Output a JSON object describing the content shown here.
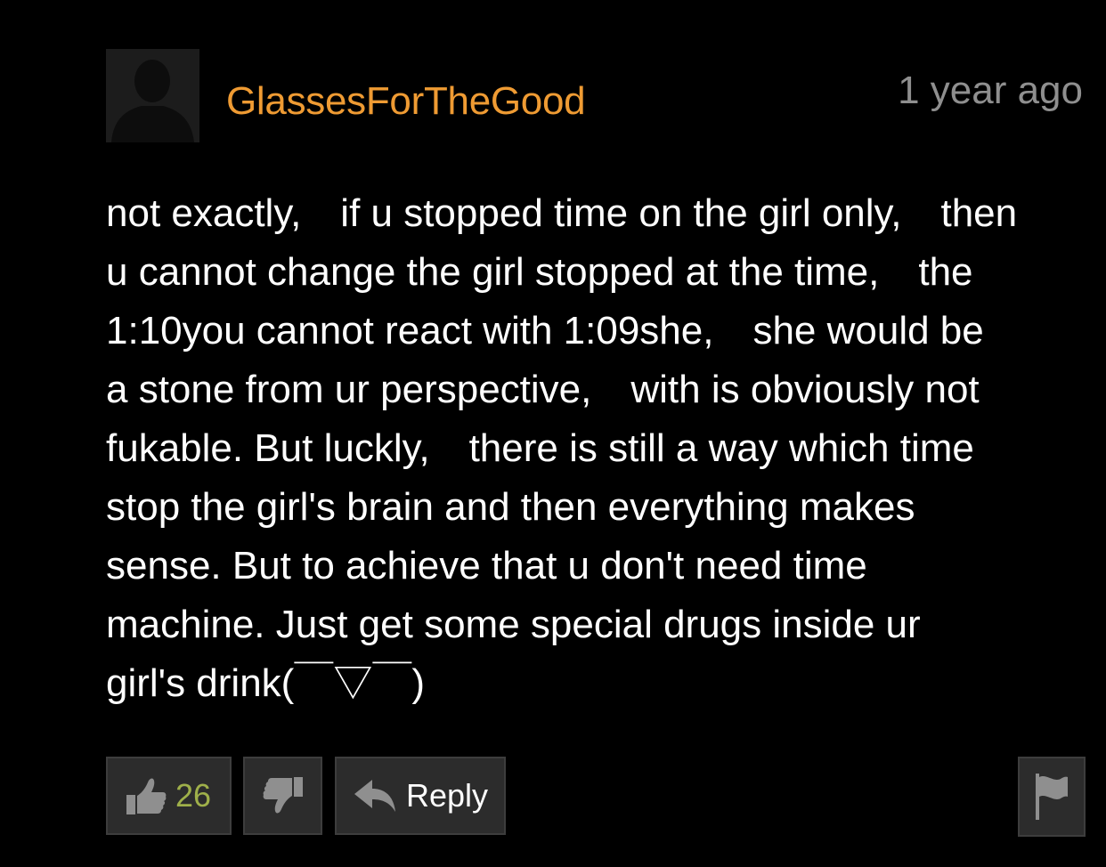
{
  "comment": {
    "username": "GlassesForTheGood",
    "timestamp": "1 year ago",
    "body_lines": [
      "not exactly,　if u stopped time on the girl only,　then",
      "u cannot change the girl stopped at the time,　the",
      "1:10you cannot react with 1:09she,　she would be",
      "a stone from ur perspective,　with is obviously not",
      "fukable. But luckly,　there is still a way which time",
      "stop the girl's brain and then everything makes",
      "sense. But to achieve that u don't need time",
      "machine. Just get some special drugs inside ur",
      "girl's drink(￣▽￣)"
    ]
  },
  "actions": {
    "like_count": "26",
    "reply_label": "Reply",
    "like_icon": "thumbs-up-icon",
    "dislike_icon": "thumbs-down-icon",
    "reply_icon": "reply-arrow-icon",
    "flag_icon": "flag-icon"
  },
  "colors": {
    "username": "#ef9b33",
    "timestamp": "#8f8f8f",
    "like_count": "#9fb04a",
    "button_bg": "#2c2c2c"
  }
}
